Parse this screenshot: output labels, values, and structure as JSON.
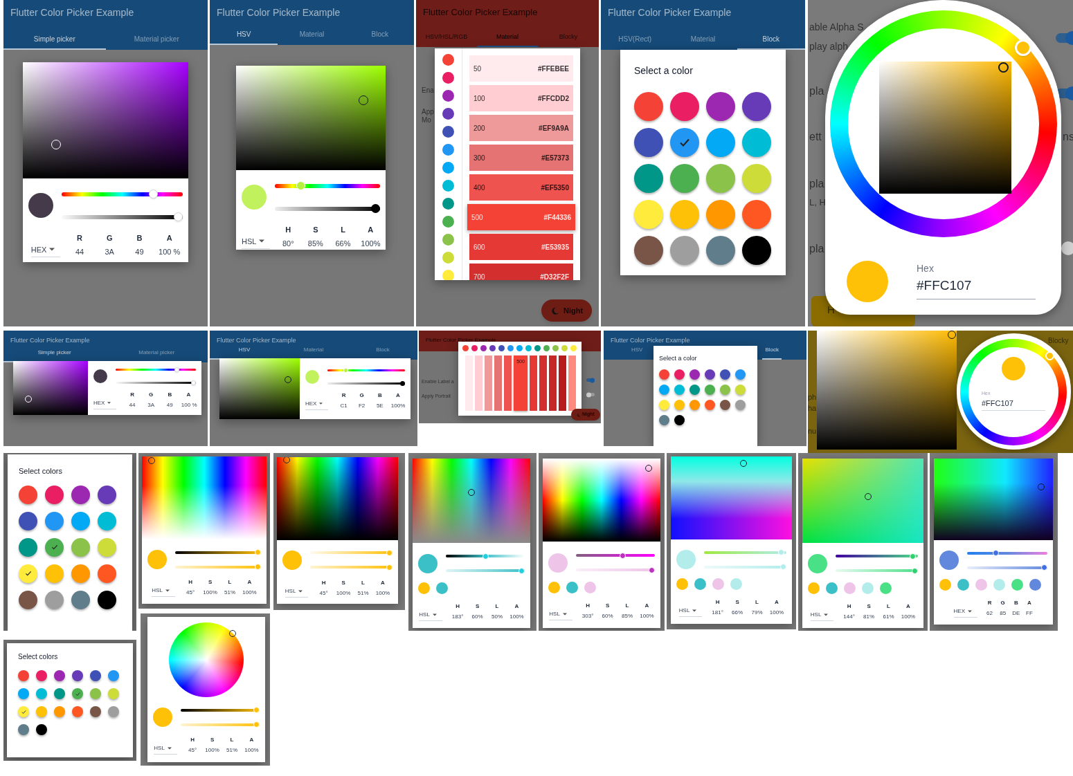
{
  "screens": [
    {
      "app_bar": {
        "title": "Flutter Color Picker Example",
        "tabs": [
          {
            "label": "Simple picker",
            "selected": true
          },
          {
            "label": "Material picker",
            "selected": false
          }
        ]
      },
      "dialog": {
        "kind": "picker",
        "sliders": [
          {
            "level": 0.78
          },
          {
            "level": 1
          }
        ],
        "mode": "HEX",
        "labels": [
          "R",
          "G",
          "B",
          "A"
        ],
        "values": [
          "44",
          "3A",
          "49",
          "100 %"
        ]
      }
    },
    {
      "app_bar": {
        "title": "Flutter Color Picker Example",
        "tabs": [
          {
            "label": "HSV",
            "selected": true
          },
          {
            "label": "Material",
            "selected": false
          },
          {
            "label": "Block",
            "selected": false
          }
        ]
      },
      "dialog": {
        "kind": "picker",
        "sliders": [
          {
            "level": 0.22
          },
          {
            "level": 1
          }
        ],
        "mode": "HSL",
        "labels": [
          "H",
          "S",
          "L",
          "A"
        ],
        "values": [
          "80°",
          "85%",
          "66%",
          "100%"
        ]
      }
    },
    {
      "app_bar": {
        "title": "Flutter Color Picker Example",
        "tabs": [
          {
            "label": "HSV/HSL/RGB",
            "selected": false
          },
          {
            "label": "Material",
            "selected": true
          },
          {
            "label": "Blocky",
            "selected": false
          }
        ]
      },
      "background": {
        "texts": [
          "Ena",
          "App",
          "Mo"
        ]
      },
      "dialog": {
        "kind": "material",
        "colors": [
          {
            "color": "#f44336",
            "selected": false
          },
          {
            "color": "#e91e63",
            "selected": false
          },
          {
            "color": "#9c27b0",
            "selected": false
          },
          {
            "color": "#673ab7",
            "selected": false
          },
          {
            "color": "#3f51b5",
            "selected": false
          },
          {
            "color": "#2196f3",
            "selected": false
          },
          {
            "color": "#03a9f4",
            "selected": false
          },
          {
            "color": "#00bcd4",
            "selected": false
          },
          {
            "color": "#009688",
            "selected": false
          },
          {
            "color": "#4caf50",
            "selected": false
          },
          {
            "color": "#8bc34a",
            "selected": false
          },
          {
            "color": "#cddc39",
            "selected": false
          },
          {
            "color": "#ffeb3b",
            "selected": false
          }
        ],
        "shades": [
          {
            "label": "50",
            "hex": "#FFEBEE",
            "color": "#ffebee",
            "selected": false
          },
          {
            "label": "100",
            "hex": "#FFCDD2",
            "color": "#ffcdd2",
            "selected": false
          },
          {
            "label": "200",
            "hex": "#EF9A9A",
            "color": "#ef9a9a",
            "selected": false
          },
          {
            "label": "300",
            "hex": "#E57373",
            "color": "#e57373",
            "selected": false
          },
          {
            "label": "400",
            "hex": "#EF5350",
            "color": "#ef5350",
            "selected": false
          },
          {
            "label": "500",
            "hex": "#F44336",
            "color": "#f44336",
            "selected": true
          },
          {
            "label": "600",
            "hex": "#E53935",
            "color": "#e53935",
            "selected": false
          },
          {
            "label": "700",
            "hex": "#D32F2F",
            "color": "#d32f2f",
            "selected": false
          }
        ]
      },
      "night_button": {
        "label": "Night"
      }
    },
    {
      "app_bar": {
        "title": "Flutter Color Picker Example",
        "tabs": [
          {
            "label": "HSV(Rect)",
            "selected": false
          },
          {
            "label": "Material",
            "selected": false
          },
          {
            "label": "Block",
            "selected": true
          }
        ]
      },
      "dialog": {
        "kind": "swatches",
        "title": "Select a color",
        "swatches": [
          {
            "color": "#f44336",
            "selected": false
          },
          {
            "color": "#e91e63",
            "selected": false
          },
          {
            "color": "#9c27b0",
            "selected": false
          },
          {
            "color": "#673ab7",
            "selected": false
          },
          {
            "color": "#3f51b5",
            "selected": false
          },
          {
            "color": "#2196f3",
            "selected": true
          },
          {
            "color": "#03a9f4",
            "selected": false
          },
          {
            "color": "#00bcd4",
            "selected": false
          },
          {
            "color": "#009688",
            "selected": false
          },
          {
            "color": "#4caf50",
            "selected": false
          },
          {
            "color": "#8bc34a",
            "selected": false
          },
          {
            "color": "#cddc39",
            "selected": false
          },
          {
            "color": "#ffeb3b",
            "selected": false
          },
          {
            "color": "#ffc107",
            "selected": false
          },
          {
            "color": "#ff9800",
            "selected": false
          },
          {
            "color": "#ff5722",
            "selected": false
          },
          {
            "color": "#795548",
            "selected": false
          },
          {
            "color": "#9e9e9e",
            "selected": false
          },
          {
            "color": "#607d8b",
            "selected": false
          },
          {
            "color": "#000000",
            "selected": false
          }
        ]
      }
    },
    {
      "background": {
        "texts": [
          "able Alpha S",
          "play alph",
          "pla",
          "ett",
          "ns",
          "pla",
          "L, H",
          "pla",
          "H"
        ],
        "switches": [
          {
            "on": true
          },
          {
            "on": true
          },
          {
            "on": false
          }
        ]
      },
      "dialog": {
        "kind": "wheel",
        "hex_label": "Hex",
        "hex_value": "#FFC107"
      }
    },
    {
      "app_bar": {
        "title": "Flutter Color Picker Example",
        "tabs": [
          {
            "label": "Simple picker",
            "selected": true
          },
          {
            "label": "Material picker",
            "selected": false
          }
        ]
      },
      "dialog": {
        "kind": "picker",
        "sliders": [
          {
            "level": 0.78
          },
          {
            "level": 1
          }
        ],
        "mode": "HEX",
        "labels": [
          "R",
          "G",
          "B",
          "A"
        ],
        "values": [
          "44",
          "3A",
          "49",
          "100 %"
        ]
      }
    },
    {
      "app_bar": {
        "title": "Flutter Color Picker Example",
        "tabs": [
          {
            "label": "HSV",
            "selected": true
          },
          {
            "label": "Material",
            "selected": false
          },
          {
            "label": "Block",
            "selected": false
          }
        ]
      },
      "dialog": {
        "kind": "picker",
        "sliders": [
          {
            "level": 0.22
          },
          {
            "level": 1
          }
        ],
        "mode": "HEX",
        "labels": [
          "R",
          "G",
          "B",
          "A"
        ],
        "values": [
          "C1",
          "F2",
          "5E",
          "100%"
        ]
      }
    },
    {
      "app_bar": {
        "title": "Flutter Color Picker Example"
      },
      "background": {
        "texts": [
          "Enable Label a",
          "Apply Portrait"
        ],
        "switches": [
          {
            "on": true
          },
          {
            "on": false
          }
        ]
      },
      "dialog": {
        "kind": "blocky",
        "colors": [
          {
            "color": "#f44336",
            "selected": false
          },
          {
            "color": "#e91e63",
            "selected": false
          },
          {
            "color": "#9c27b0",
            "selected": false
          },
          {
            "color": "#673ab7",
            "selected": false
          },
          {
            "color": "#3f51b5",
            "selected": false
          },
          {
            "color": "#2196f3",
            "selected": false
          },
          {
            "color": "#03a9f4",
            "selected": false
          },
          {
            "color": "#00bcd4",
            "selected": false
          },
          {
            "color": "#009688",
            "selected": false
          },
          {
            "color": "#4caf50",
            "selected": false
          },
          {
            "color": "#8bc34a",
            "selected": false
          },
          {
            "color": "#cddc39",
            "selected": false
          },
          {
            "color": "#ffeb3b",
            "selected": false
          }
        ],
        "shades": [
          {
            "color": "#ffebee",
            "selected": false
          },
          {
            "color": "#ffcdd2",
            "selected": false
          },
          {
            "color": "#ef9a9a",
            "selected": false
          },
          {
            "color": "#e57373",
            "selected": false
          },
          {
            "color": "#ef5350",
            "selected": false
          },
          {
            "color": "#f44336",
            "selected": true,
            "label": "500"
          },
          {
            "color": "#e53935",
            "selected": false
          },
          {
            "color": "#d32f2f",
            "selected": false
          },
          {
            "color": "#c62828",
            "selected": false
          },
          {
            "color": "#b71c1c",
            "selected": false
          },
          {
            "color": "#ff8a80",
            "selected": false
          }
        ]
      },
      "night_button": {
        "label": "Night"
      }
    },
    {
      "app_bar": {
        "title": "Flutter Color Picker Example",
        "tabs": [
          {
            "label": "HSV",
            "selected": false
          },
          {
            "label": "Block",
            "selected": true
          }
        ]
      },
      "dialog": {
        "kind": "swatches",
        "title": "Select a color",
        "swatches": [
          {
            "color": "#f44336",
            "selected": false
          },
          {
            "color": "#e91e63",
            "selected": false
          },
          {
            "color": "#9c27b0",
            "selected": false
          },
          {
            "color": "#673ab7",
            "selected": false
          },
          {
            "color": "#3f51b5",
            "selected": false
          },
          {
            "color": "#2196f3",
            "selected": false
          },
          {
            "color": "#03a9f4",
            "selected": false
          },
          {
            "color": "#00bcd4",
            "selected": false
          },
          {
            "color": "#009688",
            "selected": false
          },
          {
            "color": "#4caf50",
            "selected": false
          },
          {
            "color": "#8bc34a",
            "selected": false
          },
          {
            "color": "#cddc39",
            "selected": false
          },
          {
            "color": "#ffeb3b",
            "selected": false
          },
          {
            "color": "#ffc107",
            "selected": false
          },
          {
            "color": "#ff9800",
            "selected": false
          },
          {
            "color": "#ff5722",
            "selected": false
          },
          {
            "color": "#795548",
            "selected": false
          },
          {
            "color": "#9e9e9e",
            "selected": false
          },
          {
            "color": "#607d8b",
            "selected": false
          },
          {
            "color": "#000000",
            "selected": false
          }
        ]
      }
    },
    {
      "background": {
        "texts": [
          "Blocky",
          "ph",
          "ha",
          "nu"
        ]
      },
      "dialog": {
        "kind": "wheel",
        "hex_label": "Hex",
        "hex_value": "#FFC107"
      }
    },
    {
      "dialog": {
        "kind": "swatches",
        "title": "Select colors",
        "swatches": [
          {
            "color": "#f44336",
            "selected": false
          },
          {
            "color": "#e91e63",
            "selected": false
          },
          {
            "color": "#9c27b0",
            "selected": false
          },
          {
            "color": "#673ab7",
            "selected": false
          },
          {
            "color": "#3f51b5",
            "selected": false
          },
          {
            "color": "#2196f3",
            "selected": false
          },
          {
            "color": "#03a9f4",
            "selected": false
          },
          {
            "color": "#00bcd4",
            "selected": false
          },
          {
            "color": "#009688",
            "selected": false
          },
          {
            "color": "#4caf50",
            "selected": true
          },
          {
            "color": "#8bc34a",
            "selected": false
          },
          {
            "color": "#cddc39",
            "selected": false
          },
          {
            "color": "#ffeb3b",
            "selected": true
          },
          {
            "color": "#ffc107",
            "selected": false
          },
          {
            "color": "#ff9800",
            "selected": false
          },
          {
            "color": "#ff5722",
            "selected": false
          },
          {
            "color": "#795548",
            "selected": false
          },
          {
            "color": "#9e9e9e",
            "selected": false
          },
          {
            "color": "#607d8b",
            "selected": false
          },
          {
            "color": "#000000",
            "selected": false
          }
        ]
      }
    },
    {
      "dialog": {
        "kind": "picker",
        "sliders": [
          {
            "level": 1
          },
          {
            "level": 1
          }
        ],
        "mode": "HSL",
        "labels": [
          "H",
          "S",
          "L",
          "A"
        ],
        "values": [
          "45°",
          "100%",
          "51%",
          "100%"
        ]
      }
    },
    {
      "dialog": {
        "kind": "picker",
        "sliders": [
          {
            "level": 1
          },
          {
            "level": 1
          }
        ],
        "mode": "HSL",
        "labels": [
          "H",
          "S",
          "L",
          "A"
        ],
        "values": [
          "45°",
          "100%",
          "51%",
          "100%"
        ]
      }
    },
    {
      "dialog": {
        "kind": "picker",
        "sliders": [
          {
            "level": 0.5
          },
          {
            "level": 1
          }
        ],
        "history": [
          {
            "color": "#ffc107"
          },
          {
            "color": "#3cc0c8"
          }
        ],
        "mode": "HSL",
        "labels": [
          "H",
          "S",
          "L",
          "A"
        ],
        "values": [
          "183°",
          "60%",
          "50%",
          "100%"
        ]
      }
    },
    {
      "dialog": {
        "kind": "picker",
        "sliders": [
          {
            "level": 0.6
          },
          {
            "level": 1
          }
        ],
        "history": [
          {
            "color": "#ffc107"
          },
          {
            "color": "#3cc0c8"
          },
          {
            "color": "#eec4e8"
          }
        ],
        "mode": "HSL",
        "labels": [
          "H",
          "S",
          "L",
          "A"
        ],
        "values": [
          "303°",
          "60%",
          "85%",
          "100%"
        ]
      }
    },
    {
      "dialog": {
        "kind": "picker",
        "sliders": [
          {
            "level": 0.97
          },
          {
            "level": 1
          }
        ],
        "history": [
          {
            "color": "#ffc107"
          },
          {
            "color": "#3cc0c8"
          },
          {
            "color": "#eec4e8"
          },
          {
            "color": "#b2edec"
          }
        ],
        "mode": "HSL",
        "labels": [
          "H",
          "S",
          "L",
          "A"
        ],
        "values": [
          "181°",
          "66%",
          "79%",
          "100%"
        ]
      }
    },
    {
      "dialog": {
        "kind": "picker",
        "sliders": [
          {
            "level": 0.97
          },
          {
            "level": 1
          }
        ],
        "history": [
          {
            "color": "#ffc107"
          },
          {
            "color": "#3cc0c8"
          },
          {
            "color": "#eec4e8"
          },
          {
            "color": "#b2edec"
          },
          {
            "color": "#4ae186"
          }
        ],
        "mode": "HSL",
        "labels": [
          "H",
          "S",
          "L",
          "A"
        ],
        "values": [
          "144°",
          "81%",
          "61%",
          "100%"
        ]
      }
    },
    {
      "dialog": {
        "kind": "picker",
        "sliders": [
          {
            "level": 0.35
          },
          {
            "level": 1
          }
        ],
        "history": [
          {
            "color": "#ffc107"
          },
          {
            "color": "#3cc0c8"
          },
          {
            "color": "#eec4e8"
          },
          {
            "color": "#b2edec"
          },
          {
            "color": "#4ae186"
          },
          {
            "color": "#6288de"
          }
        ],
        "mode": "HEX",
        "labels": [
          "R",
          "G",
          "B",
          "A"
        ],
        "values": [
          "62",
          "85",
          "DE",
          "FF"
        ]
      }
    },
    {
      "dialog": {
        "kind": "swatches",
        "title": "Select colors",
        "swatches": [
          {
            "color": "#f44336",
            "selected": false
          },
          {
            "color": "#e91e63",
            "selected": false
          },
          {
            "color": "#9c27b0",
            "selected": false
          },
          {
            "color": "#673ab7",
            "selected": false
          },
          {
            "color": "#3f51b5",
            "selected": false
          },
          {
            "color": "#2196f3",
            "selected": false
          },
          {
            "color": "#03a9f4",
            "selected": false
          },
          {
            "color": "#00bcd4",
            "selected": false
          },
          {
            "color": "#009688",
            "selected": false
          },
          {
            "color": "#4caf50",
            "selected": true
          },
          {
            "color": "#8bc34a",
            "selected": false
          },
          {
            "color": "#cddc39",
            "selected": false
          },
          {
            "color": "#ffeb3b",
            "selected": true
          },
          {
            "color": "#ffc107",
            "selected": false
          },
          {
            "color": "#ff9800",
            "selected": false
          },
          {
            "color": "#ff5722",
            "selected": false
          },
          {
            "color": "#795548",
            "selected": false
          },
          {
            "color": "#9e9e9e",
            "selected": false
          },
          {
            "color": "#607d8b",
            "selected": false
          },
          {
            "color": "#000000",
            "selected": false
          }
        ]
      }
    },
    {
      "dialog": {
        "kind": "picker",
        "sliders": [
          {
            "level": 1
          },
          {
            "level": 1
          }
        ],
        "mode": "HSL",
        "labels": [
          "H",
          "S",
          "L",
          "A"
        ],
        "values": [
          "45°",
          "100%",
          "51%",
          "100%"
        ]
      }
    }
  ]
}
